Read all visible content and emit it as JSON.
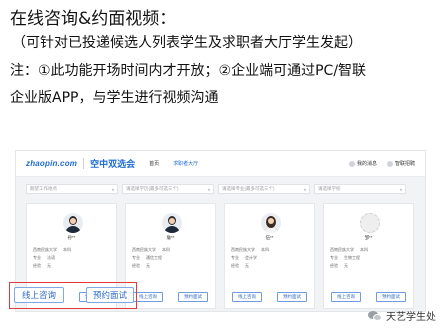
{
  "title": "在线咨询&约面视频：",
  "subtitle": "（可针对已投递候选人列表学生及求职者大厅学生发起）",
  "note_line1": "注：①此功能开场时间内才开放；②企业端可通过PC/智联",
  "note_line2": "企业版APP，与学生进行视频沟通",
  "screen": {
    "nav": {
      "logo": "zhaopin.com",
      "brand": "空中双选会",
      "links": [
        "首页",
        "求职者大厅"
      ],
      "active_link_index": 1,
      "right_items": [
        "我的消息",
        "智联招聘"
      ]
    },
    "filters": [
      {
        "placeholder": "期望工作地点"
      },
      {
        "placeholder": "请选择学历(最多可选三个)"
      },
      {
        "placeholder": "请选择专业(最多可选三个)"
      },
      {
        "placeholder": "请选择学校"
      }
    ],
    "cards": [
      {
        "name": "孙**",
        "school": "西南民族大学",
        "degree": "本科",
        "major_label": "专业",
        "major": "法语",
        "exp_label": "经验",
        "exp": "无",
        "consult_label": "线上咨询",
        "interview_label": "预约面试"
      },
      {
        "name": "詹**",
        "school": "西南民族大学",
        "degree": "本科",
        "major_label": "专业",
        "major": "通信工程",
        "exp_label": "经验",
        "exp": "无",
        "consult_label": "线上咨询",
        "interview_label": "预约面试"
      },
      {
        "name": "伍**",
        "school": "西南民族大学",
        "degree": "本科",
        "major_label": "专业",
        "major": "会计学",
        "exp_label": "经验",
        "exp": "无",
        "consult_label": "线上咨询",
        "interview_label": "预约面试"
      },
      {
        "name": "邹**",
        "school": "西南民族大学",
        "degree": "本科",
        "major_label": "专业",
        "major": "生物工程",
        "exp_label": "经验",
        "exp": "无",
        "consult_label": "线上咨询",
        "interview_label": "预约面试"
      }
    ]
  },
  "highlight": {
    "consult_label": "线上咨询",
    "interview_label": "预约面试",
    "border_color": "#e23a3a"
  },
  "watermark": "天艺学生处",
  "colors": {
    "accent": "#2e6bc6",
    "brand": "#1d6ad1"
  }
}
